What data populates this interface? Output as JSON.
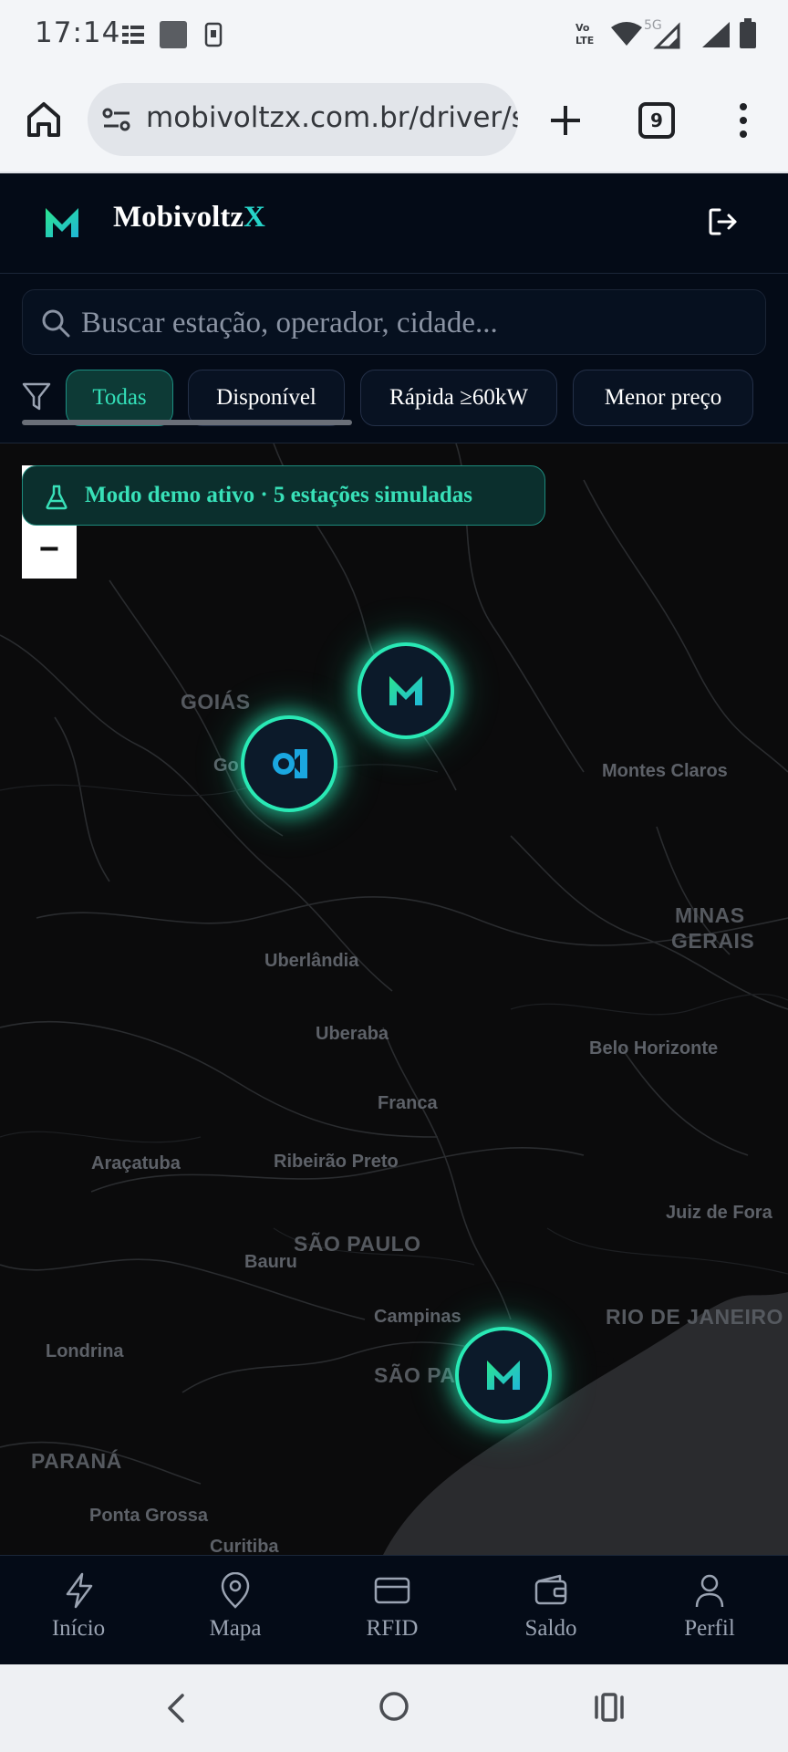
{
  "status_bar": {
    "time": "17:14",
    "icons": [
      "notification-icon",
      "image-icon",
      "phone-icon",
      "volte-icon",
      "wifi-icon",
      "signal-5g-icon",
      "signal-icon",
      "battery-icon"
    ]
  },
  "browser": {
    "url": "mobivoltzx.com.br/driver/st",
    "tab_count": "9",
    "icons": [
      "home-icon",
      "site-settings-icon",
      "new-tab-icon",
      "tab-switcher-icon",
      "more-vert-icon"
    ]
  },
  "header": {
    "brand_main": "Mobivoltz",
    "brand_accent": "X",
    "icons": [
      "logo-icon",
      "logout-icon"
    ]
  },
  "search": {
    "placeholder": "Buscar estação, operador, cidade..."
  },
  "filters": [
    {
      "label": "Todas",
      "active": true
    },
    {
      "label": "Disponível",
      "active": false
    },
    {
      "label": "Rápida ≥60kW",
      "active": false
    },
    {
      "label": "Menor preço",
      "active": false
    }
  ],
  "map": {
    "zoom_out_label": "−",
    "demo_banner": "Modo demo ativo · 5 estações simuladas",
    "labels": {
      "goias": "GOIÁS",
      "go_partial": "Go",
      "montes_claros": "Montes Claros",
      "minas_1": "MINAS",
      "minas_2": "GERAIS",
      "uberlandia": "Uberlândia",
      "uberaba": "Uberaba",
      "belo_horizonte": "Belo Horizonte",
      "franca": "Franca",
      "aracatuba": "Araçatuba",
      "ribeirao_preto": "Ribeirão Preto",
      "juiz_de_fora": "Juiz de Fora",
      "sao_paulo_state": "SÃO PAULO",
      "bauru": "Bauru",
      "campinas": "Campinas",
      "rio_de_janeiro": "RIO DE JANEIRO",
      "londrina": "Londrina",
      "sao_paulo_city": "SÃO PA",
      "parana": "PARANÁ",
      "ponta_grossa": "Ponta Grossa",
      "curitiba": "Curitiba"
    }
  },
  "nav": [
    {
      "label": "Início",
      "icon": "lightning-icon"
    },
    {
      "label": "Mapa",
      "icon": "map-pin-icon"
    },
    {
      "label": "RFID",
      "icon": "card-icon"
    },
    {
      "label": "Saldo",
      "icon": "wallet-icon"
    },
    {
      "label": "Perfil",
      "icon": "user-icon"
    }
  ],
  "colors": {
    "accent": "#29e9b5",
    "brand_accent": "#26d3c8",
    "header_bg": "#040b17",
    "map_bg": "#0b0b0c"
  }
}
